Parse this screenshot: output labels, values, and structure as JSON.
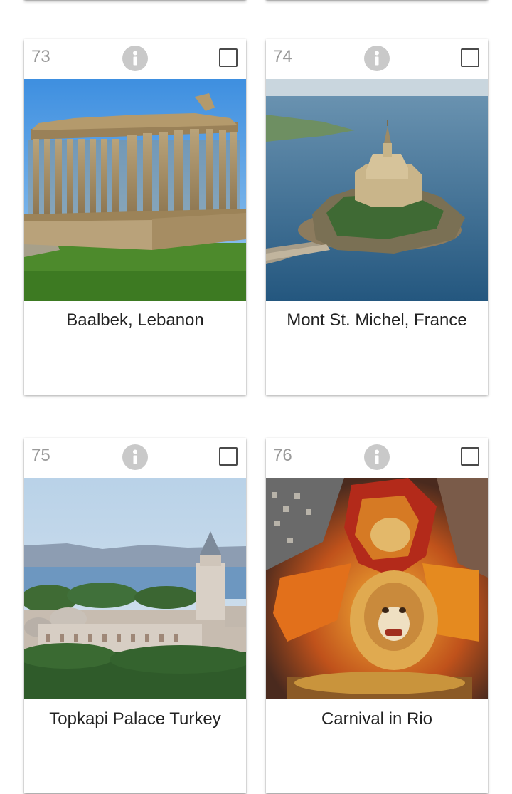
{
  "cards": [
    {
      "number": "73",
      "title": "Baalbek, Lebanon",
      "image": "Baalbek temple ruins"
    },
    {
      "number": "74",
      "title": "Mont St. Michel, France",
      "image": "Mont Saint-Michel island abbey"
    },
    {
      "number": "75",
      "title": "Topkapi Palace Turkey",
      "image": "Topkapi Palace skyline over the Bosphorus"
    },
    {
      "number": "76",
      "title": "Carnival in Rio",
      "image": "Carnival float with a lion figure"
    }
  ],
  "icons": {
    "info": "info-circle-icon",
    "select": "checkbox-icon"
  },
  "colors": {
    "number_text": "#9a9a9a",
    "info_icon": "#c9c9c9",
    "caption_text": "#222222"
  }
}
